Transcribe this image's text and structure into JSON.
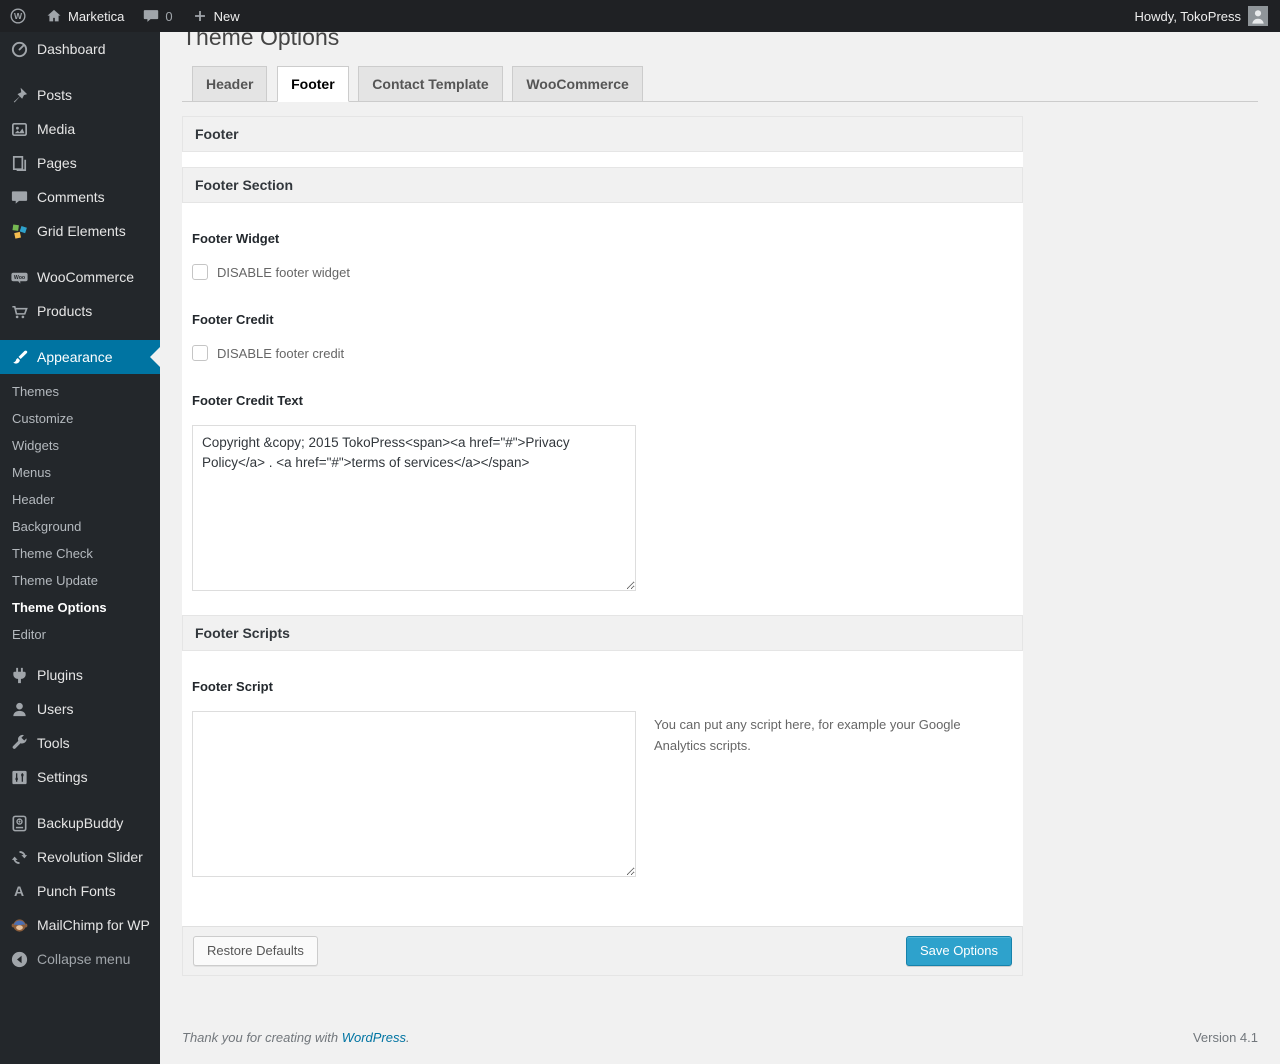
{
  "admin_bar": {
    "wp_logo_letter": "W",
    "site_name": "Marketica",
    "comments_count": "0",
    "new_label": "New",
    "howdy_text": "Howdy, TokoPress"
  },
  "sidebar": {
    "items": [
      "Dashboard",
      "Posts",
      "Media",
      "Pages",
      "Comments",
      "Grid Elements",
      "WooCommerce",
      "Products",
      "Appearance",
      "Plugins",
      "Users",
      "Tools",
      "Settings",
      "BackupBuddy",
      "Revolution Slider",
      "Punch Fonts",
      "MailChimp for WP"
    ],
    "woo_badge_text": "Woo",
    "punch_fonts_letter": "A",
    "appearance_submenu": [
      "Themes",
      "Customize",
      "Widgets",
      "Menus",
      "Header",
      "Background",
      "Theme Check",
      "Theme Update",
      "Theme Options",
      "Editor"
    ],
    "current_submenu_item": "Theme Options",
    "collapse_label": "Collapse menu"
  },
  "main": {
    "page_title": "Theme Options",
    "tabs": [
      "Header",
      "Footer",
      "Contact Template",
      "WooCommerce"
    ],
    "active_tab": "Footer",
    "box_title": "Footer",
    "footer_section": {
      "title": "Footer Section",
      "widget_label": "Footer Widget",
      "widget_checkbox_label": "DISABLE footer widget",
      "widget_checkbox_checked": false,
      "credit_label": "Footer Credit",
      "credit_checkbox_label": "DISABLE footer credit",
      "credit_checkbox_checked": false,
      "credit_text_label": "Footer Credit Text",
      "credit_text_value": "Copyright &copy; 2015 TokoPress<span><a href=\"#\">Privacy Policy</a> . <a href=\"#\">terms of services</a></span>"
    },
    "footer_scripts": {
      "title": "Footer Scripts",
      "script_label": "Footer Script",
      "script_value": "",
      "script_help": "You can put any script here, for example your Google Analytics scripts."
    },
    "actions": {
      "restore_label": "Restore Defaults",
      "save_label": "Save Options"
    }
  },
  "page_footer": {
    "thanks_prefix": "Thank you for creating with ",
    "wordpress_link": "WordPress",
    "thanks_suffix": ".",
    "version": "Version 4.1"
  },
  "colors": {
    "accent_blue": "#0074a2",
    "button_blue": "#2ea2cc",
    "admin_bar_bg": "#1f2124",
    "sidebar_bg": "#23272b",
    "page_bg": "#f1f1f1"
  }
}
